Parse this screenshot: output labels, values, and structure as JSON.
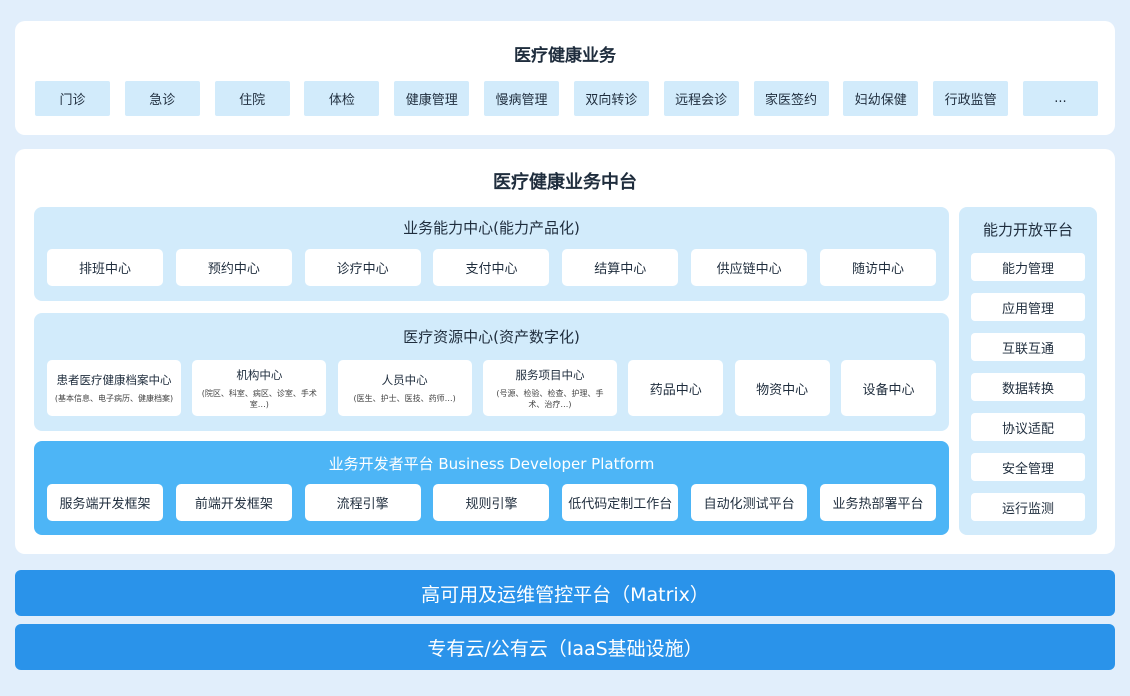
{
  "business": {
    "title": "医疗健康业务",
    "items": [
      "门诊",
      "急诊",
      "住院",
      "体检",
      "健康管理",
      "慢病管理",
      "双向转诊",
      "远程会诊",
      "家医签约",
      "妇幼保健",
      "行政监管",
      "..."
    ]
  },
  "middle_platform": {
    "title": "医疗健康业务中台",
    "capability_center": {
      "title": "业务能力中心(能力产品化)",
      "items": [
        "排班中心",
        "预约中心",
        "诊疗中心",
        "支付中心",
        "结算中心",
        "供应链中心",
        "随访中心"
      ]
    },
    "resource_center": {
      "title": "医疗资源中心(资产数字化)",
      "items": [
        {
          "name": "患者医疗健康档案中心",
          "detail": "(基本信息、电子病历、健康档案)"
        },
        {
          "name": "机构中心",
          "detail": "(院区、科室、病区、诊室、手术室…)"
        },
        {
          "name": "人员中心",
          "detail": "(医生、护士、医技、药师…)"
        },
        {
          "name": "服务项目中心",
          "detail": "(号源、检验、检查、护理、手术、治疗…)"
        },
        {
          "name": "药品中心",
          "detail": ""
        },
        {
          "name": "物资中心",
          "detail": ""
        },
        {
          "name": "设备中心",
          "detail": ""
        }
      ]
    },
    "developer_platform": {
      "title": "业务开发者平台 Business Developer Platform",
      "items": [
        "服务端开发框架",
        "前端开发框架",
        "流程引擎",
        "规则引擎",
        "低代码定制工作台",
        "自动化测试平台",
        "业务热部署平台"
      ]
    },
    "open_platform": {
      "title": "能力开放平台",
      "items": [
        "能力管理",
        "应用管理",
        "互联互通",
        "数据转换",
        "协议适配",
        "安全管理",
        "运行监测"
      ]
    }
  },
  "bars": {
    "matrix": "高可用及运维管控平台（Matrix）",
    "iaas": "专有云/公有云（IaaS基础设施）"
  },
  "colors": {
    "light_blue": "#d2ebfb",
    "dev_blue": "#4db5f6",
    "bar_blue": "#2a93ea",
    "background": "#e1eefb"
  }
}
